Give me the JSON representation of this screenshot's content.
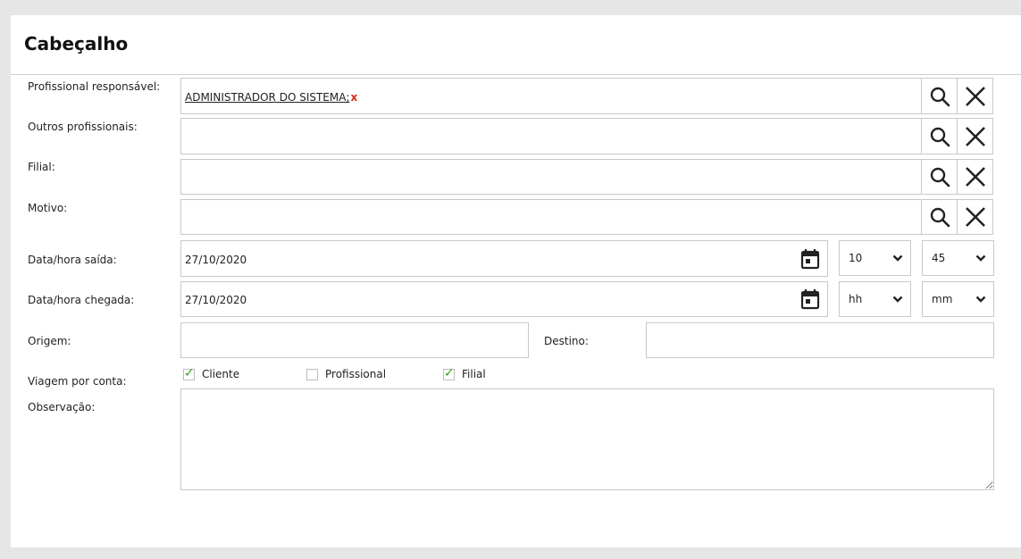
{
  "section": {
    "title": "Cabeçalho"
  },
  "fields": {
    "profissional": {
      "label": "Profissional responsável:",
      "value": "ADMINISTRADOR DO SISTEMA;",
      "remove": "x"
    },
    "outros": {
      "label": "Outros profissionais:",
      "value": ""
    },
    "filial": {
      "label": "Filial:",
      "value": ""
    },
    "motivo": {
      "label": "Motivo:",
      "value": ""
    },
    "saida": {
      "label": "Data/hora saída:",
      "date": "27/10/2020",
      "hour": "10",
      "minute": "45"
    },
    "chegada": {
      "label": "Data/hora chegada:",
      "date": "27/10/2020",
      "hour": "hh",
      "minute": "mm"
    },
    "origem": {
      "label": "Origem:",
      "value": ""
    },
    "destino": {
      "label": "Destino:",
      "value": ""
    },
    "viagem": {
      "label": "Viagem por conta:",
      "options": [
        {
          "label": "Cliente",
          "checked": true
        },
        {
          "label": "Profissional",
          "checked": false
        },
        {
          "label": "Filial",
          "checked": true
        }
      ]
    },
    "observacao": {
      "label": "Observação:",
      "value": ""
    }
  },
  "colors": {
    "check": "#3a9d1b",
    "remove": "#d9281b",
    "border": "#c8c8c8"
  },
  "icons": [
    "search-icon",
    "close-icon",
    "calendar-icon",
    "chevron-down-icon",
    "check-icon"
  ]
}
